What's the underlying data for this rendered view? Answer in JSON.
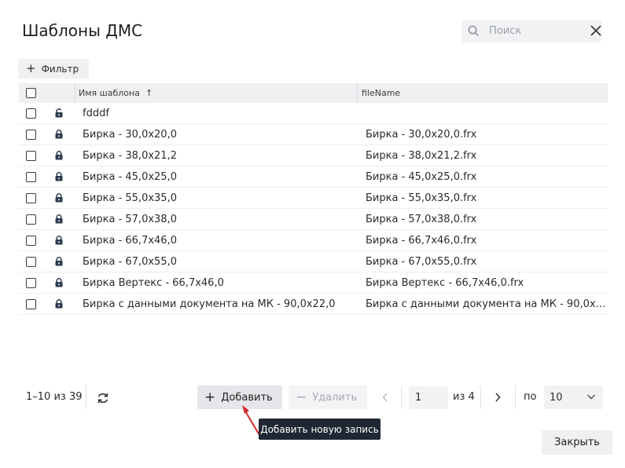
{
  "dialog": {
    "title": "Шаблоны ДМС",
    "search_placeholder": "Поиск",
    "filter_label": "Фильтр",
    "close_label": "Закрыть"
  },
  "grid": {
    "col_name": "Имя шаблона",
    "col_file": "fileName",
    "rows": [
      {
        "name": "fdddf",
        "file": ""
      },
      {
        "name": "Бирка - 30,0x20,0",
        "file": "Бирка - 30,0x20,0.frx"
      },
      {
        "name": "Бирка - 38,0x21,2",
        "file": "Бирка - 38,0x21,2.frx"
      },
      {
        "name": "Бирка - 45,0x25,0",
        "file": "Бирка - 45,0x25,0.frx"
      },
      {
        "name": "Бирка - 55,0x35,0",
        "file": "Бирка - 55,0x35,0.frx"
      },
      {
        "name": "Бирка - 57,0x38,0",
        "file": "Бирка - 57,0x38,0.frx"
      },
      {
        "name": "Бирка - 66,7x46,0",
        "file": "Бирка - 66,7x46,0.frx"
      },
      {
        "name": "Бирка - 67,0x55,0",
        "file": "Бирка - 67,0x55,0.frx"
      },
      {
        "name": "Бирка Вертекс - 66,7x46,0",
        "file": "Бирка Вертекс - 66,7x46,0.frx"
      },
      {
        "name": "Бирка с данными документа на МК - 90,0x22,0",
        "file": "Бирка с данными документа на МК - 90,0x22,..."
      }
    ]
  },
  "footer": {
    "count": "1–10 из 39",
    "add_label": "Добавить",
    "delete_label": "Удалить",
    "page_value": "1",
    "of_pages": "из 4",
    "per_label": "по",
    "per_page_value": "10",
    "tooltip": "Добавить новую запись"
  },
  "colors": {
    "tooltip_bg": "#1e2733",
    "arrow_annotation": "#d62828",
    "header_bg": "#eef0f2"
  }
}
